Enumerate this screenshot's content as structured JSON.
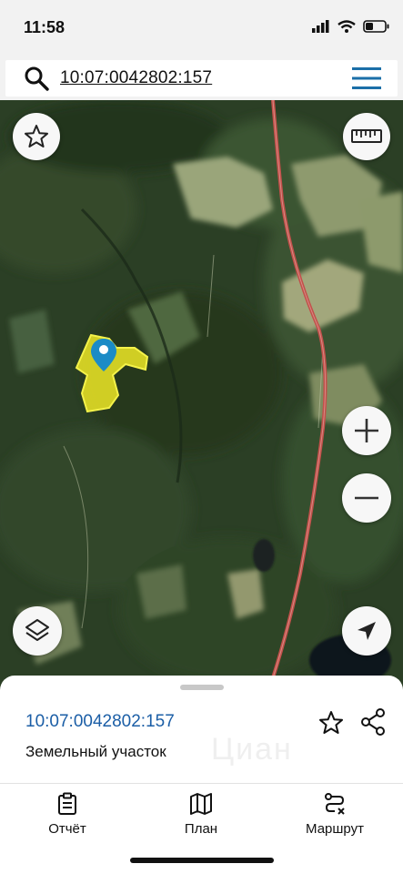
{
  "status_bar": {
    "time": "11:58"
  },
  "search": {
    "query": "10:07:0042802:157"
  },
  "map": {
    "buttons": {
      "favorite": "star-icon",
      "measure": "ruler-icon",
      "zoom_in": "plus-icon",
      "zoom_out": "minus-icon",
      "layers": "layers-icon",
      "locate": "navigation-arrow-icon"
    },
    "colors": {
      "parcel_fill": "#e8e226",
      "parcel_stroke": "#f4f24a",
      "road": "#c2504a",
      "marker": "#1b8bc6"
    }
  },
  "sheet": {
    "cadastral_number": "10:07:0042802:157",
    "parcel_type": "Земельный участок",
    "watermark": "Циан",
    "tabs": [
      {
        "label": "Отчёт",
        "icon": "report-clipboard-icon"
      },
      {
        "label": "План",
        "icon": "map-plan-icon"
      },
      {
        "label": "Маршрут",
        "icon": "route-icon"
      }
    ]
  },
  "accent_color": "#1b5ea6"
}
